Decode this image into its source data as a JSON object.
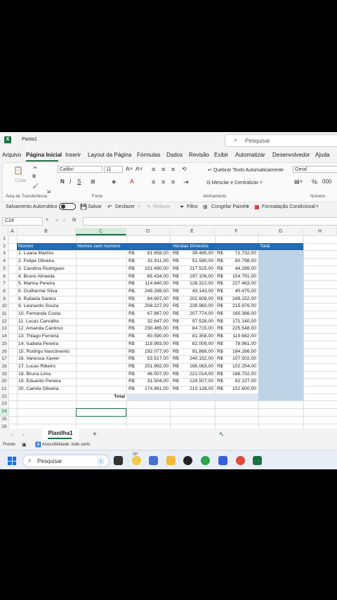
{
  "titlebar": {
    "app_icon": "X",
    "doc_title": "Pasta1",
    "search_placeholder": "Pesquisar"
  },
  "menu": [
    "Arquivo",
    "Página Inicial",
    "Inserir",
    "Layout da Página",
    "Fórmulas",
    "Dados",
    "Revisão",
    "Exibir",
    "Automatizar",
    "Desenvolvedor",
    "Ajuda"
  ],
  "ribbon": {
    "paste": "Colar",
    "clipboard_group": "Área de Transferência",
    "font_name": "Calibri",
    "font_size": "11",
    "font_group": "Fonte",
    "wrap_text": "Quebrar Texto Automaticamente",
    "merge_center": "Mesclar e Centralizar",
    "alignment_group": "Alinhamento",
    "number_format": "Geral",
    "number_group": "Número"
  },
  "qat": {
    "autosave": "Salvamento Automático",
    "save": "Salvar",
    "undo": "Desfazer",
    "redo": "Refazer",
    "filter": "Filtro",
    "freeze": "Congelar Painéis",
    "cond_format": "Formatação Condicional"
  },
  "formula_bar": {
    "name_box": "C24",
    "fx": "fx"
  },
  "columns": [
    "A",
    "B",
    "C",
    "D",
    "E",
    "F",
    "G",
    "H"
  ],
  "sheet": {
    "headers": {
      "names": "Nomes",
      "no_number": "Nomes sem numero",
      "sales": "Vendas trimestre",
      "total": "Total"
    },
    "currency": "R$",
    "total_label": "Total",
    "rows": [
      {
        "name": "1. Luana Martins",
        "d": "81.658,00",
        "e": "39.485,00",
        "f": "71.732,00"
      },
      {
        "name": "2. Felipe Oliveira",
        "d": "91.911,00",
        "e": "51.580,00",
        "f": "80.798,00"
      },
      {
        "name": "3. Carolina Rodrigues",
        "d": "151.490,00",
        "e": "217.515,00",
        "f": "44.299,00"
      },
      {
        "name": "4. Bruno Almeida",
        "d": "65.434,00",
        "e": "197.106,00",
        "f": "154.791,00"
      },
      {
        "name": "5. Marina Pereira",
        "d": "114.840,00",
        "e": "128.312,00",
        "f": "227.463,00"
      },
      {
        "name": "6. Guilherme Silva",
        "d": "249.288,00",
        "e": "43.143,00",
        "f": "40.475,00"
      },
      {
        "name": "8. Rafaela Santos",
        "d": "84.697,00",
        "e": "202.609,00",
        "f": "249.152,00"
      },
      {
        "name": "9. Leonardo Souza",
        "d": "208.227,00",
        "e": "239.960,00",
        "f": "215.876,00"
      },
      {
        "name": "10. Fernanda Costa",
        "d": "67.867,00",
        "e": "207.774,00",
        "f": "160.366,00"
      },
      {
        "name": "11. Lucas Carvalho",
        "d": "32.647,00",
        "e": "97.528,00",
        "f": "171.140,00"
      },
      {
        "name": "12. Amanda Cardoso",
        "d": "230.465,00",
        "e": "84.715,00",
        "f": "225.548,00"
      },
      {
        "name": "13. Thiago Ferreira",
        "d": "60.590,00",
        "e": "81.358,00",
        "f": "119.682,00"
      },
      {
        "name": "14. Isabela Pereira",
        "d": "118.993,00",
        "e": "82.009,00",
        "f": "78.961,00"
      },
      {
        "name": "15. Rodrigo Nascimento",
        "d": "192.077,00",
        "e": "91.868,00",
        "f": "184.266,00"
      },
      {
        "name": "16. Vanessa Xavier",
        "d": "53.517,00",
        "e": "240.152,00",
        "f": "107.502,00"
      },
      {
        "name": "17. Lucas Ribeiro",
        "d": "201.992,00",
        "e": "165.063,00",
        "f": "102.254,00"
      },
      {
        "name": "18. Bruna Lima",
        "d": "46.507,00",
        "e": "221.014,00",
        "f": "188.732,00"
      },
      {
        "name": "19. Eduardo Pereira",
        "d": "31.504,00",
        "e": "129.507,00",
        "f": "92.227,00"
      },
      {
        "name": "20. Camila Oliveira",
        "d": "174.861,00",
        "e": "210.128,00",
        "f": "152.600,00"
      }
    ]
  },
  "tabs": {
    "sheet": "Planilha1",
    "add": "+"
  },
  "status": {
    "ready": "Pronto",
    "accessibility": "Acessibilidade: tudo certo"
  },
  "taskbar": {
    "search": "Pesquisar",
    "weather": "20°"
  },
  "colors": {
    "excel_green": "#1e7145",
    "header_blue": "#1e6bb8",
    "total_fill": "#bed3e6"
  }
}
